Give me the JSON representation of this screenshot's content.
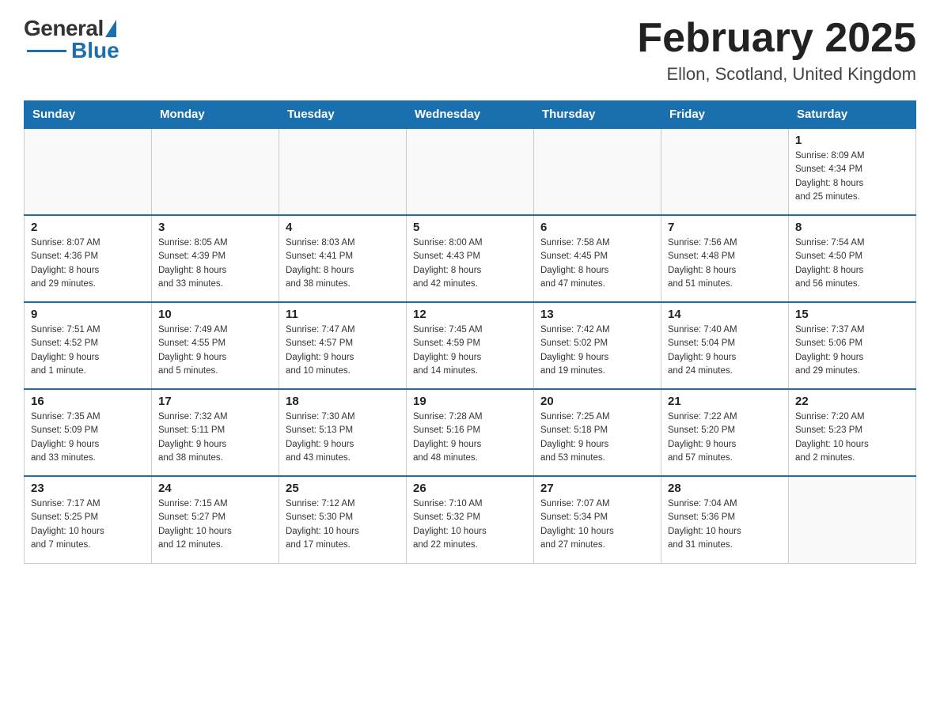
{
  "header": {
    "logo_general": "General",
    "logo_blue": "Blue",
    "month_title": "February 2025",
    "location": "Ellon, Scotland, United Kingdom"
  },
  "days_of_week": [
    "Sunday",
    "Monday",
    "Tuesday",
    "Wednesday",
    "Thursday",
    "Friday",
    "Saturday"
  ],
  "weeks": [
    {
      "days": [
        {
          "number": "",
          "info": ""
        },
        {
          "number": "",
          "info": ""
        },
        {
          "number": "",
          "info": ""
        },
        {
          "number": "",
          "info": ""
        },
        {
          "number": "",
          "info": ""
        },
        {
          "number": "",
          "info": ""
        },
        {
          "number": "1",
          "info": "Sunrise: 8:09 AM\nSunset: 4:34 PM\nDaylight: 8 hours\nand 25 minutes."
        }
      ]
    },
    {
      "days": [
        {
          "number": "2",
          "info": "Sunrise: 8:07 AM\nSunset: 4:36 PM\nDaylight: 8 hours\nand 29 minutes."
        },
        {
          "number": "3",
          "info": "Sunrise: 8:05 AM\nSunset: 4:39 PM\nDaylight: 8 hours\nand 33 minutes."
        },
        {
          "number": "4",
          "info": "Sunrise: 8:03 AM\nSunset: 4:41 PM\nDaylight: 8 hours\nand 38 minutes."
        },
        {
          "number": "5",
          "info": "Sunrise: 8:00 AM\nSunset: 4:43 PM\nDaylight: 8 hours\nand 42 minutes."
        },
        {
          "number": "6",
          "info": "Sunrise: 7:58 AM\nSunset: 4:45 PM\nDaylight: 8 hours\nand 47 minutes."
        },
        {
          "number": "7",
          "info": "Sunrise: 7:56 AM\nSunset: 4:48 PM\nDaylight: 8 hours\nand 51 minutes."
        },
        {
          "number": "8",
          "info": "Sunrise: 7:54 AM\nSunset: 4:50 PM\nDaylight: 8 hours\nand 56 minutes."
        }
      ]
    },
    {
      "days": [
        {
          "number": "9",
          "info": "Sunrise: 7:51 AM\nSunset: 4:52 PM\nDaylight: 9 hours\nand 1 minute."
        },
        {
          "number": "10",
          "info": "Sunrise: 7:49 AM\nSunset: 4:55 PM\nDaylight: 9 hours\nand 5 minutes."
        },
        {
          "number": "11",
          "info": "Sunrise: 7:47 AM\nSunset: 4:57 PM\nDaylight: 9 hours\nand 10 minutes."
        },
        {
          "number": "12",
          "info": "Sunrise: 7:45 AM\nSunset: 4:59 PM\nDaylight: 9 hours\nand 14 minutes."
        },
        {
          "number": "13",
          "info": "Sunrise: 7:42 AM\nSunset: 5:02 PM\nDaylight: 9 hours\nand 19 minutes."
        },
        {
          "number": "14",
          "info": "Sunrise: 7:40 AM\nSunset: 5:04 PM\nDaylight: 9 hours\nand 24 minutes."
        },
        {
          "number": "15",
          "info": "Sunrise: 7:37 AM\nSunset: 5:06 PM\nDaylight: 9 hours\nand 29 minutes."
        }
      ]
    },
    {
      "days": [
        {
          "number": "16",
          "info": "Sunrise: 7:35 AM\nSunset: 5:09 PM\nDaylight: 9 hours\nand 33 minutes."
        },
        {
          "number": "17",
          "info": "Sunrise: 7:32 AM\nSunset: 5:11 PM\nDaylight: 9 hours\nand 38 minutes."
        },
        {
          "number": "18",
          "info": "Sunrise: 7:30 AM\nSunset: 5:13 PM\nDaylight: 9 hours\nand 43 minutes."
        },
        {
          "number": "19",
          "info": "Sunrise: 7:28 AM\nSunset: 5:16 PM\nDaylight: 9 hours\nand 48 minutes."
        },
        {
          "number": "20",
          "info": "Sunrise: 7:25 AM\nSunset: 5:18 PM\nDaylight: 9 hours\nand 53 minutes."
        },
        {
          "number": "21",
          "info": "Sunrise: 7:22 AM\nSunset: 5:20 PM\nDaylight: 9 hours\nand 57 minutes."
        },
        {
          "number": "22",
          "info": "Sunrise: 7:20 AM\nSunset: 5:23 PM\nDaylight: 10 hours\nand 2 minutes."
        }
      ]
    },
    {
      "days": [
        {
          "number": "23",
          "info": "Sunrise: 7:17 AM\nSunset: 5:25 PM\nDaylight: 10 hours\nand 7 minutes."
        },
        {
          "number": "24",
          "info": "Sunrise: 7:15 AM\nSunset: 5:27 PM\nDaylight: 10 hours\nand 12 minutes."
        },
        {
          "number": "25",
          "info": "Sunrise: 7:12 AM\nSunset: 5:30 PM\nDaylight: 10 hours\nand 17 minutes."
        },
        {
          "number": "26",
          "info": "Sunrise: 7:10 AM\nSunset: 5:32 PM\nDaylight: 10 hours\nand 22 minutes."
        },
        {
          "number": "27",
          "info": "Sunrise: 7:07 AM\nSunset: 5:34 PM\nDaylight: 10 hours\nand 27 minutes."
        },
        {
          "number": "28",
          "info": "Sunrise: 7:04 AM\nSunset: 5:36 PM\nDaylight: 10 hours\nand 31 minutes."
        },
        {
          "number": "",
          "info": ""
        }
      ]
    }
  ]
}
